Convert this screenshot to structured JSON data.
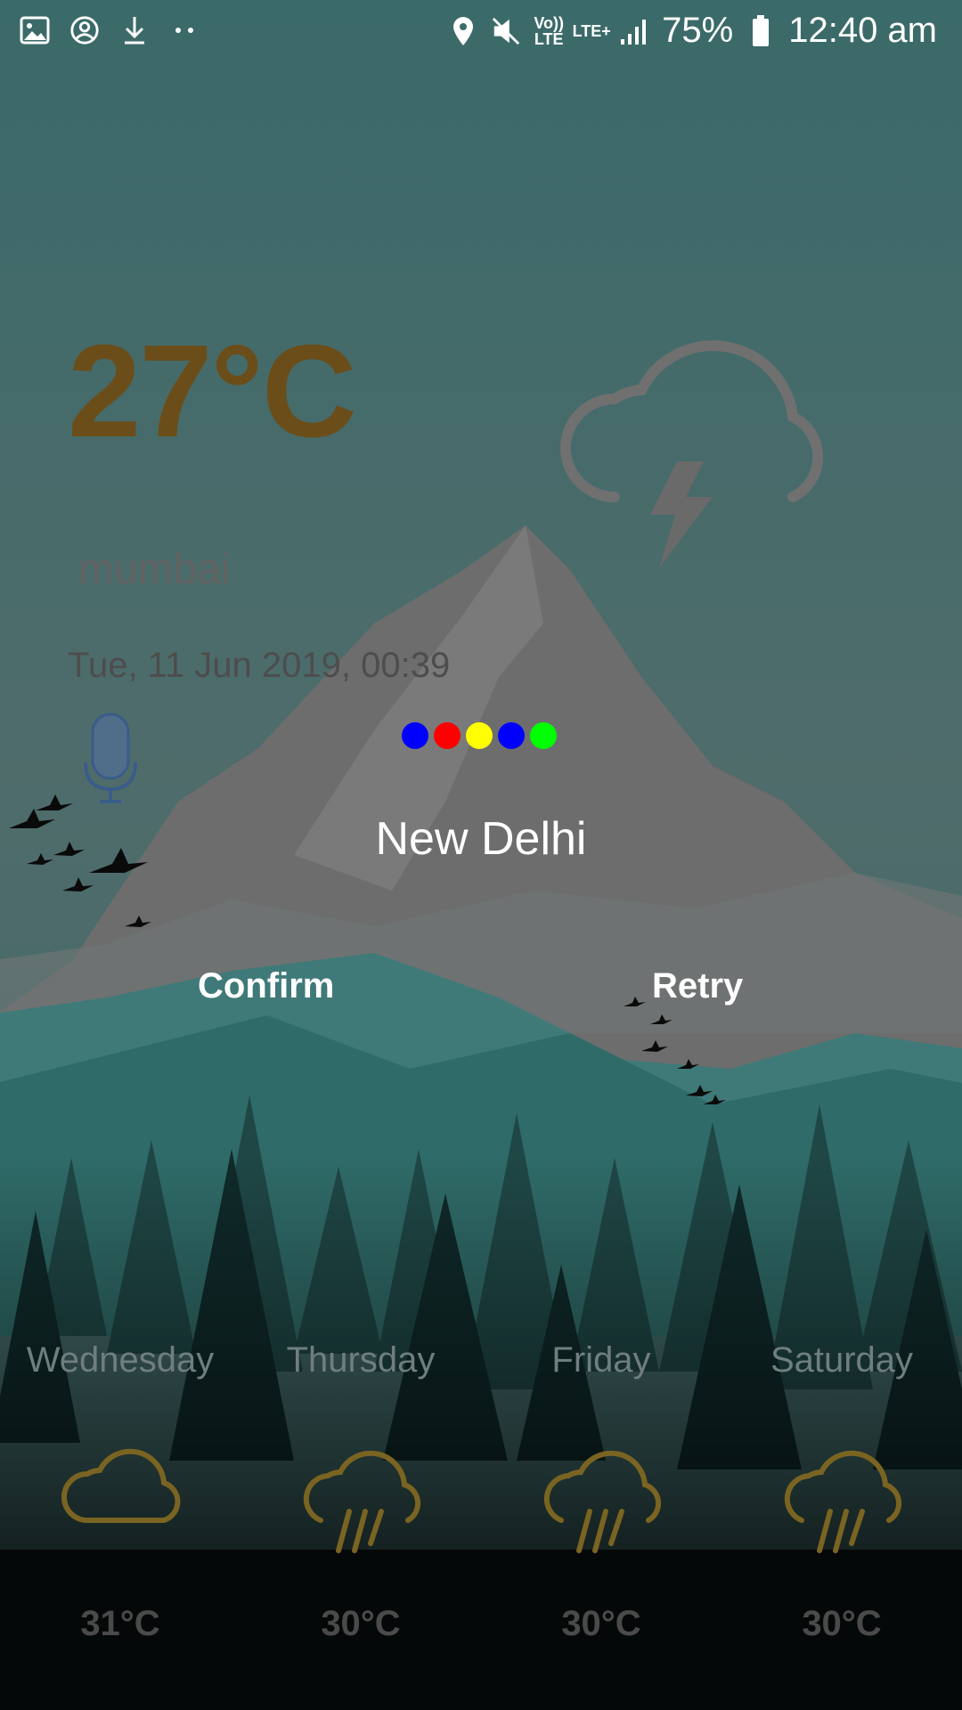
{
  "status_bar": {
    "left_icons": [
      "image-icon",
      "account-circle-icon",
      "download-icon",
      "more-dots-icon"
    ],
    "right_icons": [
      "location-pin-icon",
      "mute-icon",
      "volte-icon",
      "lte-plus-icon",
      "signal-icon",
      "battery-icon"
    ],
    "volte_label": "Vo)) LTE",
    "lte_label": "LTE+",
    "battery_percent": "75%",
    "time": "12:40 am"
  },
  "current": {
    "temperature": "27°C",
    "city": "mumbai",
    "datetime": "Tue, 11 Jun 2019, 00:39",
    "condition_icon": "thunderstorm-cloud-icon",
    "mic_icon": "microphone-icon"
  },
  "voice_dialog": {
    "listening_dot_colors": [
      "#0000ff",
      "#ff0000",
      "#ffff00",
      "#0000ff",
      "#00ff00"
    ],
    "recognized_text": "New Delhi",
    "confirm_label": "Confirm",
    "retry_label": "Retry"
  },
  "forecast": [
    {
      "day": "Wednesday",
      "icon": "cloud-icon",
      "temp": "31°C"
    },
    {
      "day": "Thursday",
      "icon": "rain-cloud-icon",
      "temp": "30°C"
    },
    {
      "day": "Friday",
      "icon": "rain-cloud-icon",
      "temp": "30°C"
    },
    {
      "day": "Saturday",
      "icon": "rain-cloud-icon",
      "temp": "30°C"
    }
  ],
  "colors": {
    "icon_gold": "#7a6422",
    "temperature": "#6b4d1a"
  }
}
